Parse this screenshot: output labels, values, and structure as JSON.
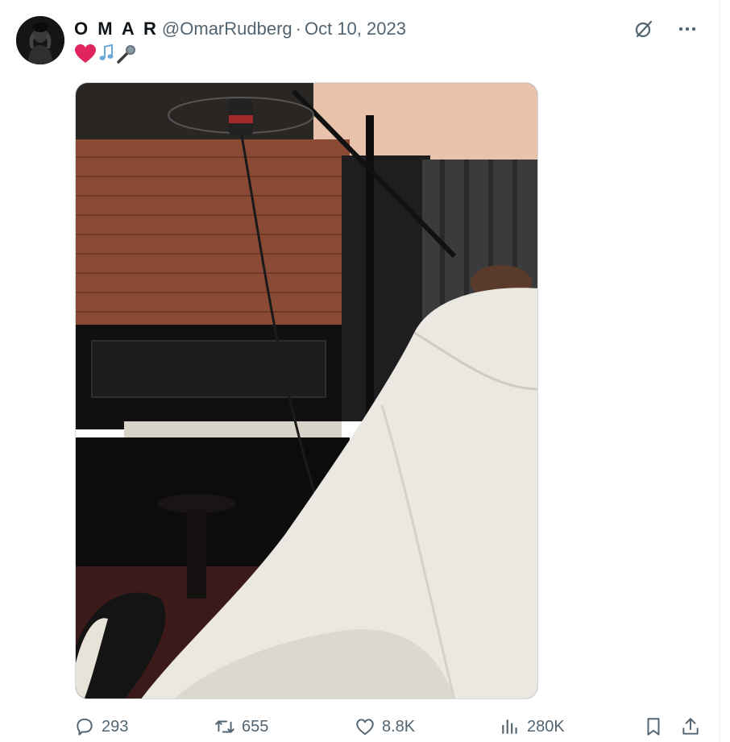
{
  "tweet": {
    "display_name": "O M A R",
    "handle": "@OmarRudberg",
    "separator": "·",
    "date": "Oct 10, 2023",
    "text_emojis": [
      "❤️",
      "🎶",
      "🎤"
    ]
  },
  "icons": {
    "top": [
      "grok-icon",
      "more-icon"
    ],
    "actions": [
      "reply-icon",
      "retweet-icon",
      "like-icon",
      "views-icon",
      "bookmark-icon",
      "share-icon"
    ]
  },
  "stats": {
    "replies": "293",
    "retweets": "655",
    "likes": "8.8K",
    "views": "280K"
  },
  "colors": {
    "text_primary": "#0f1419",
    "text_secondary": "#536471",
    "heart_red": "#e0245e",
    "divider": "#eff3f4"
  }
}
